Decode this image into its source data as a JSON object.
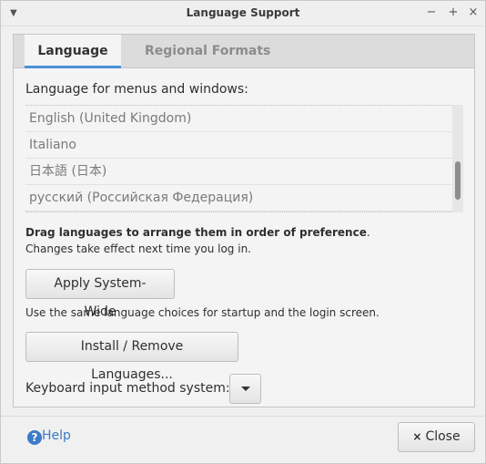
{
  "window": {
    "title": "Language Support",
    "menu_icon": "chevron-down-icon",
    "controls": {
      "minimize": "−",
      "maximize": "+",
      "close": "×"
    }
  },
  "tabs": [
    {
      "label": "Language",
      "active": true
    },
    {
      "label": "Regional Formats",
      "active": false
    }
  ],
  "language": {
    "heading": "Language for menus and windows:",
    "list": [
      "English (United Kingdom)",
      "Italiano",
      "日本語 (日本)",
      "русский (Российская Федерация)"
    ],
    "drag_hint_bold": "Drag languages to arrange them in order of preference",
    "drag_hint_end": ".",
    "changes_hint": "Changes take effect next time you log in.",
    "apply_button": "Apply System-Wide",
    "system_hint": "Use the same language choices for startup and the login screen.",
    "install_button": "Install / Remove Languages...",
    "keyboard_label": "Keyboard input method system:"
  },
  "footer": {
    "help_label": "Help",
    "help_icon": "?",
    "close_label": "Close",
    "close_icon": "×"
  },
  "colors": {
    "accent": "#4a90d9",
    "help_link": "#3b7ac8"
  }
}
